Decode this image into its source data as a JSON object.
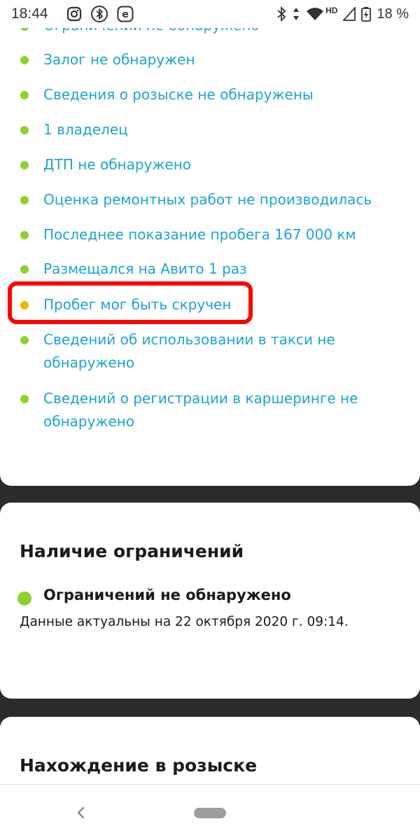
{
  "status_bar": {
    "time": "18:44",
    "notification_icons": [
      "instagram-icon",
      "bluetooth-icon",
      "e-app-icon"
    ],
    "system_icons": [
      "bluetooth-icon",
      "data-arrows-icon",
      "wifi-icon",
      "battery-icon"
    ],
    "network_badge": "HD",
    "battery_percent": "18 %"
  },
  "checks": {
    "partial_top": "Ограничений не обнаружено",
    "items": [
      {
        "text": "Залог не обнаружен",
        "status": "ok"
      },
      {
        "text": "Сведения о розыске не обнаружены",
        "status": "ok"
      },
      {
        "text": "1 владелец",
        "status": "ok"
      },
      {
        "text": "ДТП не обнаружено",
        "status": "ok"
      },
      {
        "text": "Оценка ремонтных работ не производилась",
        "status": "ok"
      },
      {
        "text": "Последнее показание пробега 167 000 км",
        "status": "ok"
      },
      {
        "text": "Размещался на Авито 1 раз",
        "status": "ok"
      },
      {
        "text": "Пробег мог быть скручен",
        "status": "warn"
      },
      {
        "text": "Сведений об использовании в такси не обнаружено",
        "status": "ok"
      },
      {
        "text": "Сведений о регистрации в каршеринге не обнаружено",
        "status": "ok"
      }
    ]
  },
  "restrictions": {
    "title": "Наличие ограничений",
    "status": "Ограничений не обнаружено",
    "date_note": "Данные актуальны на 22 октября 2020 г. 09:14."
  },
  "wanted": {
    "title": "Нахождение в розыске"
  },
  "colors": {
    "ok": "#8fd12b",
    "warn": "#f5b400",
    "link": "#1aa6cc",
    "highlight": "#ff0000"
  },
  "nav": {
    "icons": [
      "back-icon",
      "home-pill"
    ]
  }
}
